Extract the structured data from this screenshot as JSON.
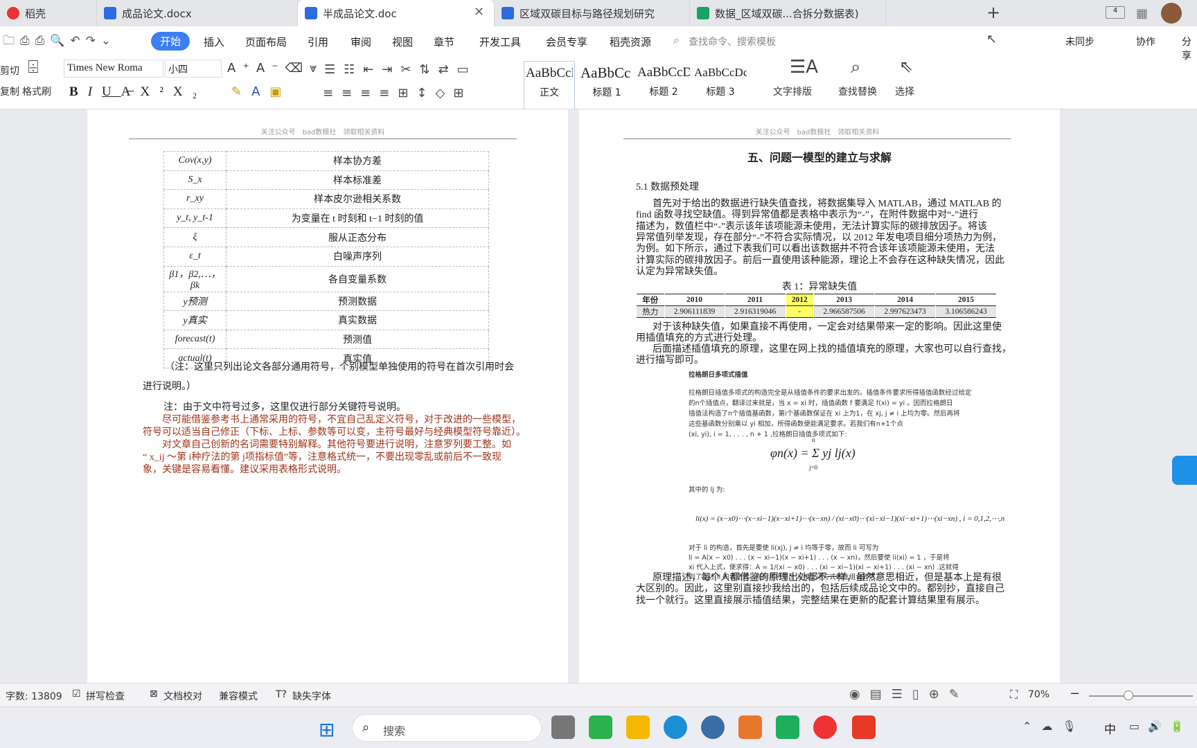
{
  "tabs": [
    {
      "label": "稻壳"
    },
    {
      "label": "成品论文.docx"
    },
    {
      "label": "半成品论文.doc"
    },
    {
      "label": "区域双碳目标与路径规划研究"
    },
    {
      "label": "数据_区域双碳...合拆分数据表)"
    }
  ],
  "colors": {
    "accent": "#3d7ef4",
    "red_text": "#a0331a",
    "highlight": "#ffff66"
  },
  "menu": [
    "开始",
    "插入",
    "页面布局",
    "引用",
    "审阅",
    "视图",
    "章节",
    "开发工具",
    "会员专享",
    "稻壳资源"
  ],
  "search": {
    "placeholder": "查找命令、搜索模板"
  },
  "topright": {
    "sync": "未同步",
    "collab": "协作",
    "share": "分享"
  },
  "ribbon": {
    "cut": "剪切",
    "copy": "复制",
    "format_painter": "格式刷",
    "font": "Times New Roma",
    "size": "小四",
    "text_layout": "文字排版",
    "find_replace": "查找替换",
    "select": "选择",
    "styles": [
      {
        "sample": "AaBbCcD",
        "label": "正文"
      },
      {
        "sample": "AaBbCc",
        "label": "标题 1"
      },
      {
        "sample": "AaBbCcD",
        "label": "标题 2"
      },
      {
        "sample": "AaBbCcDc",
        "label": "标题 3"
      }
    ]
  },
  "page_header": "关注公众号　bad数模社　领取相关资料",
  "symbols": [
    [
      "Cov(x,y)",
      "样本协方差"
    ],
    [
      "S_x",
      "样本标准差"
    ],
    [
      "r_xy",
      "样本皮尔逊相关系数"
    ],
    [
      "y_t, y_t-1",
      "为变量在 t 时刻和 t−1 时刻的值"
    ],
    [
      "ξ",
      "服从正态分布"
    ],
    [
      "ε_t",
      "白噪声序列"
    ],
    [
      "β1，β2,⋯，βk",
      "各自变量系数"
    ],
    [
      "y预测",
      "预测数据"
    ],
    [
      "y真实",
      "真实数据"
    ],
    [
      "forecast(t)",
      "预测值"
    ],
    [
      "actual(t)",
      "真实值"
    ]
  ],
  "left_notes": {
    "n1": "（注：这里只列出论文各部分通用符号，个别模型单独使用的符号在首次引用时会",
    "n1b": "进行说明。）",
    "n2": "注：由于文中符号过多，这里仅进行部分关键符号说明。",
    "r1": "尽可能借鉴参考书上通常采用的符号，不宜自己乱定义符号，对于改进的一些模型，",
    "r1b": "符号可以适当自己修正（下标、上标、参数等可以变，主符号最好与经典模型符号靠近）。",
    "r2": "对文章自己创新的名词需要特别解释。其他符号要进行说明，注意罗列要工整。如",
    "r2b": "“ x_ij ～第 i种疗法的第 j项指标值”等，注意格式统一，不要出现零乱或前后不一致现",
    "r2c": "象，关键是容易看懂。建议采用表格形式说明。"
  },
  "right": {
    "h5": "五、问题一模型的建立与求解",
    "h51": "5.1  数据预处理",
    "para1": [
      "首先对于给出的数据进行缺失值查找，将数据集导入 MATLAB，通过 MATLAB 的",
      "find 函数寻找空缺值。得到异常值都是表格中表示为“-”，在附件数据中对“-”进行",
      "描述为，数值栏中“-”表示该年该项能源未使用，无法计算实际的碳排放因子。将该",
      "异常值列举发现，存在部分“-”不符合实际情况，以 2012 年发电项目细分项热力为例，",
      "为例。如下所示，通过下表我们可以看出该数据并不符合该年该项能源未使用，无法",
      "计算实际的碳排放因子。前后一直使用该种能源，理论上不会存在这种缺失情况，因此",
      "认定为异常缺失值。"
    ],
    "table_title": "表 1：异常缺失值",
    "table_head": [
      "年份",
      "2010",
      "2011",
      "2012",
      "2013",
      "2014",
      "2015"
    ],
    "table_row": [
      "热力",
      "2.906111839",
      "2.916319046",
      "-",
      "2.966587506",
      "2.997623473",
      "3.106586243"
    ],
    "para2": [
      "对于该种缺失值，如果直接不再使用，一定会对结果带来一定的影响。因此这里使",
      "用插值填充的方式进行处理。"
    ],
    "para3": [
      "后面描述插值填充的原理，这里在网上找的插值填充的原理，大家也可以自行查找，",
      "进行描写即可。"
    ],
    "lag_title": "拉格朗日多项式插值",
    "lag_lines": [
      "拉格朗日插值多项式的构造完全是从插值条件的要求出发的。插值条件要求所得插值函数经过给定",
      "的n个插值点，翻译过来就是，当 x = xi 时，插值函数 f 要满足 f(xi) = yi 。因而拉格朗日",
      "插值法构造了n个插值基函数，第i个基函数保证在 xi 上为1，在 xj, j ≠ i 上均为零。然后再将",
      "这些基函数分别乘以 yi 相加，所得函数便能满足要求。若我们有n+1个点",
      "(xi, yi), i = 1, . . . , n + 1 ,拉格朗日插值多项式如下:"
    ],
    "formula1": "φn(x) = Σ yj lj(x)",
    "formula1_top": "n",
    "formula1_bot": "j=0",
    "where": "其中的 lj 为:",
    "formula2": "li(x) = (x−x0)⋯(x−xi−1)(x−xi+1)⋯(x−xn) / (xi−x0)⋯(xi−xi−1)(xi−xi+1)⋯(xi−xn) ,  i = 0,1,2,⋯,n",
    "lag_lines2": [
      "对于 li 的构造，首先是要使 li(xj), j ≠ i 均等于零，故而 li 可写为",
      "li = A(x − x0) . . . (x − xi−1)(x − xi+1) . . . (x − xn)，然后要使 li(xi) = 1 ，于是将",
      "xi 代入上式，便求得：A = 1/(xi − x0) . . . (xi − xi−1)(xi − xi+1) . . . (xi − xn) .这就得",
      "到了上述 li 的表达式。然后再将每个 li 按上述方式线性组合即可。"
    ],
    "para4": [
      "原理描述，每个人都借鉴的原理出处都不一样，虽然意思相近，但是基本上是有很",
      "大区别的。因此，这里别直接抄我给出的，包括后续成品论文中的。都别抄，直接自己",
      "找一个就行。这里直接展示插值结果，完整结果在更新的配套计算结果里有展示。"
    ]
  },
  "status": {
    "wordcount": "字数: 13809",
    "spell": "拼写检查",
    "proof": "文档校对",
    "compat": "兼容模式",
    "missingfont": "缺失字体",
    "zoom": "70%"
  },
  "taskbar": {
    "search": "搜索",
    "ime": "中"
  }
}
